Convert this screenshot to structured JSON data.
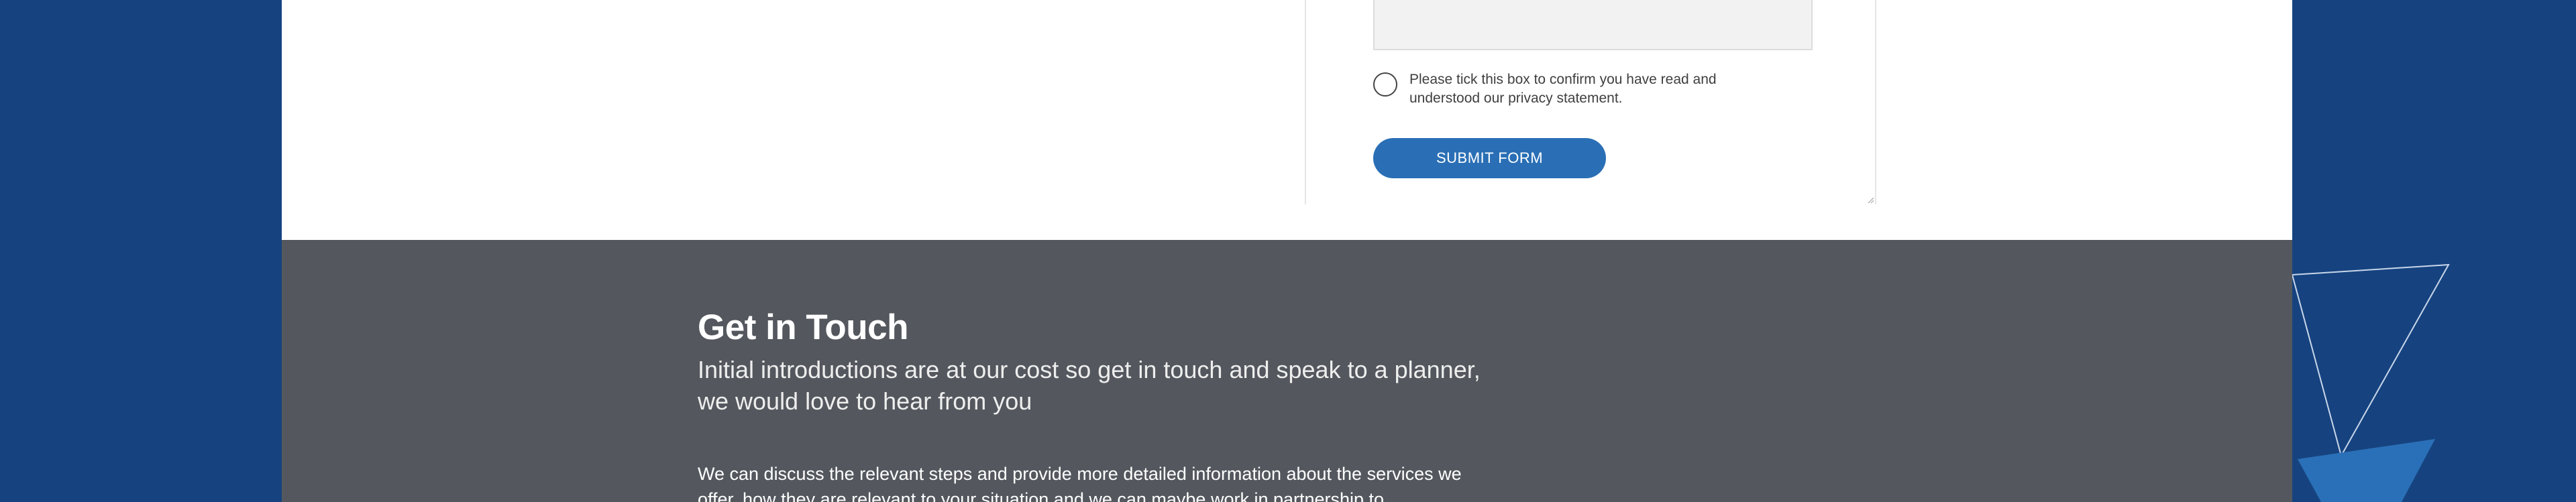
{
  "form": {
    "message_value": "",
    "consent_text": "Please tick this box to confirm you have read and understood our privacy statement.",
    "submit_label": "SUBMIT FORM"
  },
  "footer": {
    "title": "Get in Touch",
    "subtitle": "Initial introductions are at our cost so get in touch and speak to a planner, we would love to hear from you",
    "body": "We can discuss the relevant steps and provide more detailed information about the services we offer, how they are relevant to your situation and we can maybe work in partnership to"
  },
  "colors": {
    "background": "#16437f",
    "accent": "#2a6fb5",
    "footer": "#54585e"
  }
}
